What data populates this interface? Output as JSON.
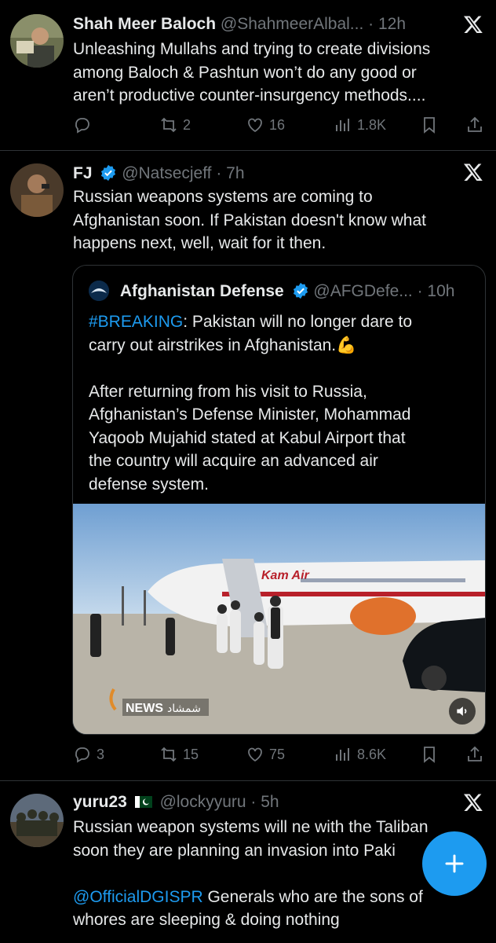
{
  "tweets": [
    {
      "name": "Shah Meer Baloch",
      "handle": "@ShahmeerAlbal...",
      "time": "· 12h",
      "lines": [
        "Unleashing Mullahs and trying to create divisions",
        "among Baloch & Pashtun won’t do any good or",
        "aren’t productive counter-insurgency methods...."
      ],
      "replies": "",
      "retweets": "2",
      "likes": "16",
      "views": "1.8K"
    },
    {
      "name": "FJ",
      "handle": "@Natsecjeff",
      "time": "· 7h",
      "lines": [
        "Russian weapons systems are coming to",
        "Afghanistan soon. If Pakistan doesn't know what",
        "happens next, well, wait for it then."
      ],
      "quote": {
        "name": "Afghanistan Defense",
        "handle": "@AFGDefe...",
        "time": "· 10h",
        "hashtag": "#BREAKING",
        "line1_rest": ": Pakistan will no longer dare to",
        "line2": "carry out airstrikes in Afghanistan.",
        "emoji": "💪",
        "para2": [
          "After returning from his visit to Russia,",
          "Afghanistan’s Defense Minister, Mohammad",
          "Yaqoob Mujahid stated at Kabul Airport that",
          "the country will acquire an advanced air",
          "defense system."
        ],
        "media": {
          "airline_text": "Kam Air",
          "watermark_latin": "NEWS",
          "watermark_arabic": "شمشاد"
        }
      },
      "replies": "3",
      "retweets": "15",
      "likes": "75",
      "views": "8.6K"
    },
    {
      "name": "yuru23",
      "handle": "@lockyyuru",
      "time": "· 5h",
      "lines": [
        "Russian weapon systems will ne with the Taliban",
        "soon they are planning an invasion into Paki"
      ],
      "mention": "@OfficialDGISPR",
      "mention_rest": " Generals who are the sons of",
      "last_line": "whores are sleeping & doing nothing"
    }
  ],
  "colors": {
    "background": "#000000",
    "text": "#e7e9ea",
    "secondary": "#71767b",
    "accent": "#1d9bf0",
    "divider": "#2f3336"
  },
  "icons": [
    "reply-icon",
    "retweet-icon",
    "like-icon",
    "views-icon",
    "bookmark-icon",
    "share-icon",
    "x-logo-icon",
    "verified-badge-icon",
    "compose-plus-icon",
    "volume-icon"
  ]
}
